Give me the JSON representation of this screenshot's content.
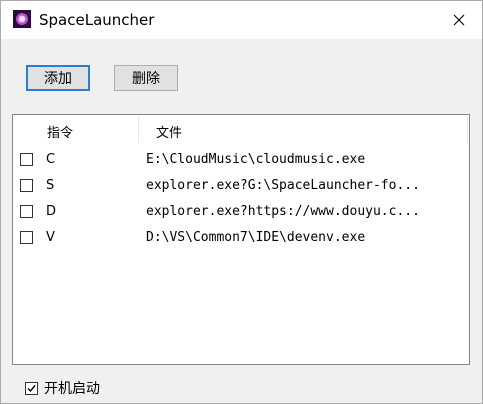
{
  "window": {
    "title": "SpaceLauncher"
  },
  "toolbar": {
    "add_label": "添加",
    "delete_label": "删除"
  },
  "list": {
    "columns": [
      "指令",
      "文件"
    ],
    "rows": [
      {
        "command": "C",
        "file": "E:\\CloudMusic\\cloudmusic.exe",
        "checked": false
      },
      {
        "command": "S",
        "file": "explorer.exe?G:\\SpaceLauncher-fo...",
        "checked": false
      },
      {
        "command": "D",
        "file": "explorer.exe?https://www.douyu.c...",
        "checked": false
      },
      {
        "command": "V",
        "file": "D:\\VS\\Common7\\IDE\\devenv.exe",
        "checked": false
      }
    ]
  },
  "autostart": {
    "label": "开机启动",
    "checked": true
  },
  "icons": {
    "app": "app-icon",
    "close": "close-icon",
    "check": "check-icon"
  }
}
